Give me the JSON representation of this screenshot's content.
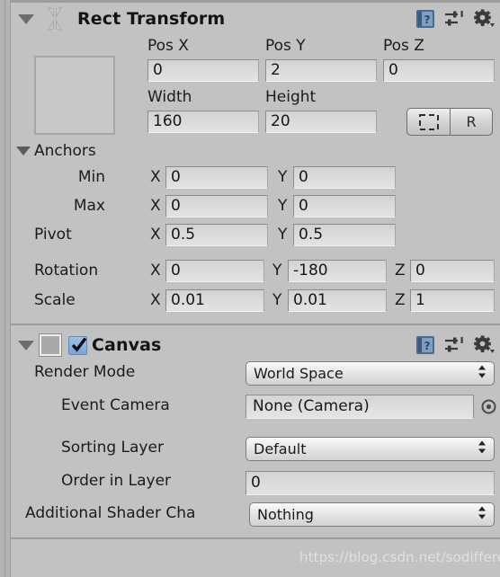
{
  "rect_transform": {
    "title": "Rect Transform",
    "icons": {
      "foldout": "triangle-down-icon",
      "component": "rect-transform-icon",
      "help": "help-book-icon",
      "preset": "preset-sliders-icon",
      "settings": "gear-icon"
    },
    "columns": {
      "pos_x": "Pos X",
      "pos_y": "Pos Y",
      "pos_z": "Pos Z",
      "width": "Width",
      "height": "Height"
    },
    "values": {
      "pos_x": "0",
      "pos_y": "2",
      "pos_z": "0",
      "width": "160",
      "height": "20"
    },
    "buttons": {
      "blueprint": "",
      "raw": "R"
    },
    "anchors": {
      "label": "Anchors",
      "rows": [
        {
          "name": "Min",
          "x_axis": "X",
          "x": "0",
          "y_axis": "Y",
          "y": "0"
        },
        {
          "name": "Max",
          "x_axis": "X",
          "x": "0",
          "y_axis": "Y",
          "y": "0"
        }
      ],
      "pivot": {
        "name": "Pivot",
        "x_axis": "X",
        "x": "0.5",
        "y_axis": "Y",
        "y": "0.5"
      }
    },
    "rotation": {
      "name": "Rotation",
      "x_axis": "X",
      "x": "0",
      "y_axis": "Y",
      "y": "-180",
      "z_axis": "Z",
      "z": "0"
    },
    "scale": {
      "name": "Scale",
      "x_axis": "X",
      "x": "0.01",
      "y_axis": "Y",
      "y": "0.01",
      "z_axis": "Z",
      "z": "1"
    }
  },
  "canvas": {
    "title": "Canvas",
    "enabled": true,
    "fields": {
      "render_mode_label": "Render Mode",
      "render_mode_value": "World Space",
      "event_camera_label": "Event Camera",
      "event_camera_value": "None (Camera)",
      "sorting_layer_label": "Sorting Layer",
      "sorting_layer_value": "Default",
      "order_in_layer_label": "Order in Layer",
      "order_in_layer_value": "0",
      "additional_shader_label": "Additional Shader Cha",
      "additional_shader_value": "Nothing"
    }
  },
  "watermark": "https://blog.csdn.net/sodifferent",
  "colors": {
    "background": "#c2c2c2",
    "field_bg": "#dcdcdc",
    "checkbox_blue": "#7ba4da",
    "text": "#1b1b1b"
  }
}
